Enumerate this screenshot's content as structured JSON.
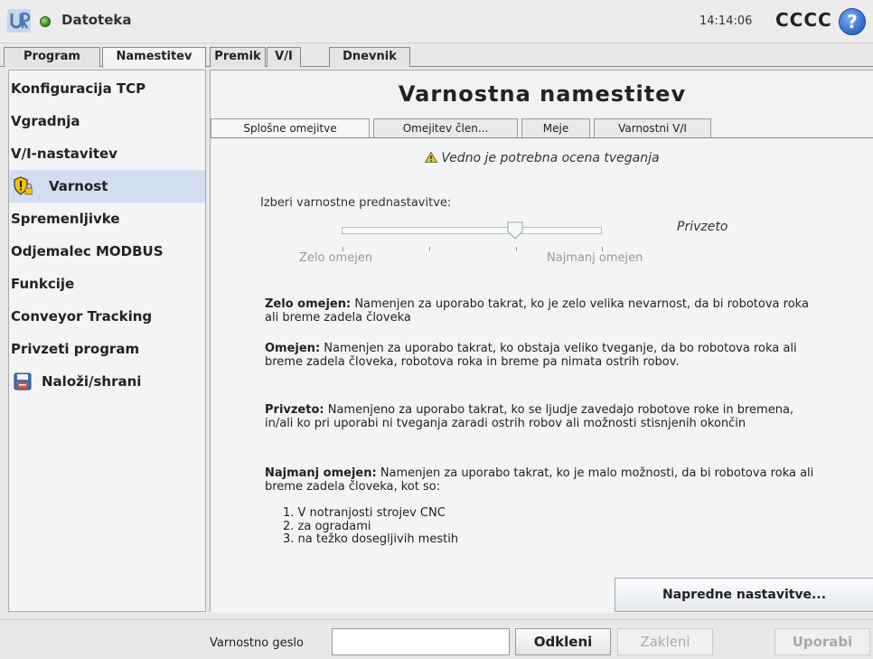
{
  "header": {
    "file_name": "Datoteka",
    "clock": "14:14:06",
    "robot_name": "CCCC",
    "help_glyph": "?"
  },
  "main_tabs": [
    {
      "label": "Program"
    },
    {
      "label": "Namestitev"
    },
    {
      "label": "Premik"
    },
    {
      "label": "V/I"
    },
    {
      "label": "Dnevnik"
    }
  ],
  "sidebar": {
    "items": [
      {
        "label": "Konfiguracija TCP"
      },
      {
        "label": "Vgradnja"
      },
      {
        "label": "V/I-nastavitev"
      },
      {
        "label": "Varnost",
        "icon": "shield-lock-icon"
      },
      {
        "label": "Spremenljivke"
      },
      {
        "label": "Odjemalec MODBUS"
      },
      {
        "label": "Funkcije"
      },
      {
        "label": "Conveyor Tracking"
      },
      {
        "label": "Privzeti program"
      },
      {
        "label": "Naloži/shrani",
        "icon": "floppy-disk-icon"
      }
    ]
  },
  "main": {
    "title": "Varnostna namestitev",
    "sub_tabs": [
      {
        "label": "Splošne omejitve"
      },
      {
        "label": "Omejitev člen..."
      },
      {
        "label": "Meje"
      },
      {
        "label": "Varnostni V/I"
      }
    ],
    "warning": "Vedno je potrebna ocena tveganja",
    "preset_label": "Izberi varnostne prednastavitve:",
    "slider": {
      "value_text": "Privzeto",
      "level": 0.667,
      "left_label": "Zelo omejen",
      "right_label": "Najmanj omejen"
    },
    "descriptions": [
      {
        "term": "Zelo omejen:",
        "text": " Namenjen za uporabo takrat, ko je zelo velika nevarnost, da bi robotova roka ali breme zadela človeka"
      },
      {
        "term": "Omejen:",
        "text": " Namenjen za uporabo takrat, ko obstaja veliko tveganje, da bo robotova roka ali breme zadela človeka, robotova roka in breme pa nimata ostrih robov."
      },
      {
        "term": "Privzeto:",
        "text": " Namenjeno za uporabo takrat, ko se ljudje zavedajo robotove roke in bremena, in/ali ko pri uporabi ni tveganja zaradi ostrih robov ali možnosti stisnjenih okončin"
      },
      {
        "term": "Najmanj omejen:",
        "text": " Namenjen za uporabo takrat, ko je malo možnosti, da bi robotova roka ali breme zadela človeka, kot so:"
      }
    ],
    "list": [
      "1. V notranjosti strojev CNC",
      "2. za ogradami",
      "3. na težko dosegljivih mestih"
    ],
    "advanced_button": "Napredne nastavitve..."
  },
  "footer": {
    "password_label": "Varnostno geslo",
    "password_value": "",
    "unlock_button": "Odkleni",
    "lock_button": "Zakleni",
    "apply_button": "Uporabi"
  },
  "colors": {
    "active_sidebar": "#d2def0",
    "status_dot": "#2f8a14",
    "help_icon": "#2a63c4",
    "warning_icon": "#e8c800"
  }
}
